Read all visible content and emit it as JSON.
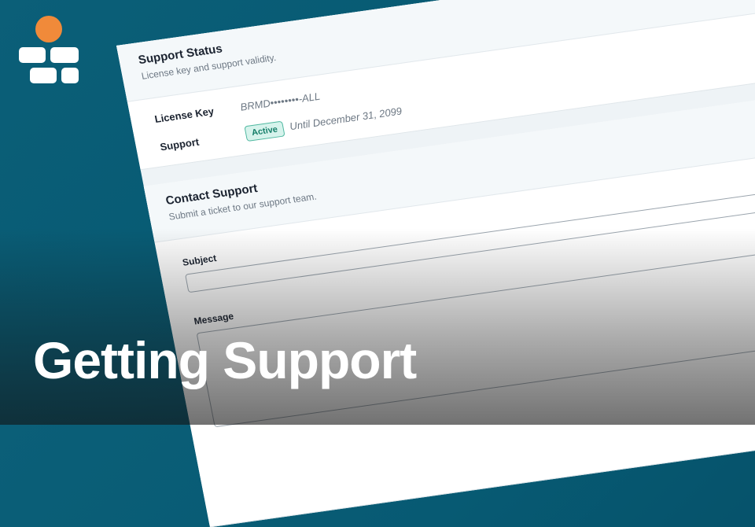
{
  "headline": "Getting Support",
  "support_status": {
    "title": "Support Status",
    "subtitle": "License key and support validity.",
    "license_key_label": "License Key",
    "license_key_value": "BRMD••••••••-ALL",
    "support_label": "Support",
    "support_badge": "Active",
    "support_until": "Until December 31, 2099"
  },
  "contact_support": {
    "title": "Contact Support",
    "subtitle": "Submit a ticket to our support team.",
    "subject_label": "Subject",
    "subject_value": "",
    "message_label": "Message",
    "message_value": ""
  },
  "colors": {
    "background": "#075a73",
    "logo_accent": "#f08a3a",
    "badge_bg": "#d6f3ec",
    "badge_text": "#137d68"
  }
}
